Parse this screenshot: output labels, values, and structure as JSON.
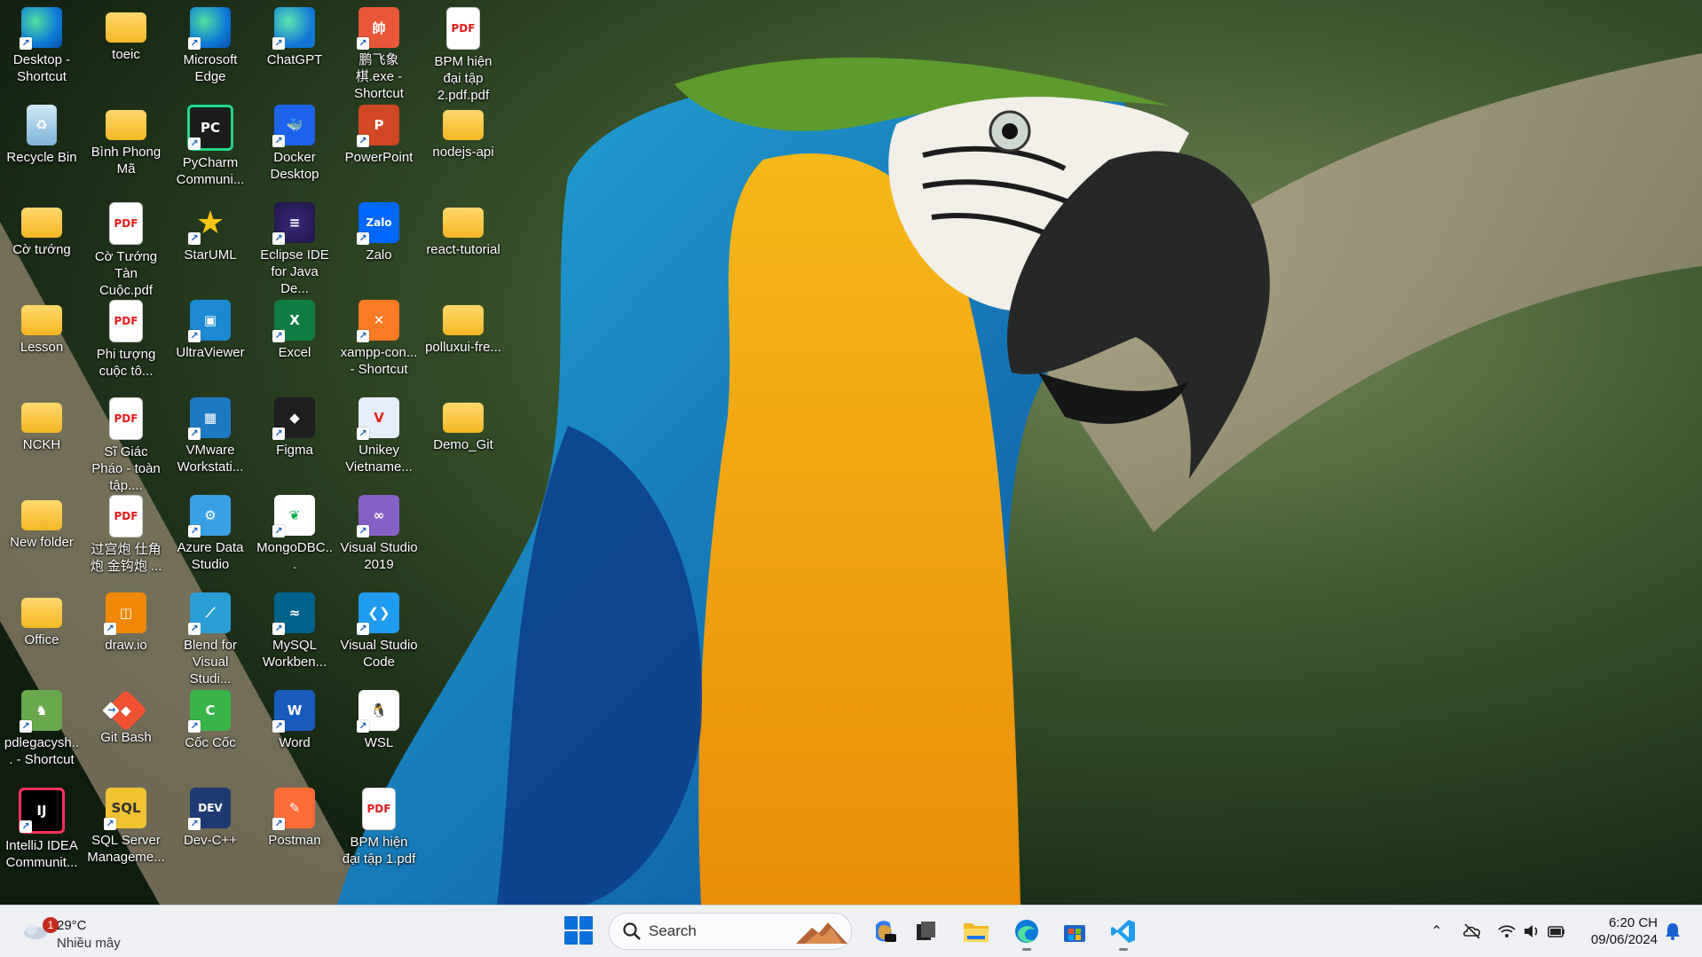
{
  "desktop": {
    "icons": [
      {
        "label": "Desktop - Shortcut",
        "icon": "desktop-icon",
        "col": 0,
        "row": 0
      },
      {
        "label": "toeic",
        "icon": "folder-icon",
        "col": 1,
        "row": 0
      },
      {
        "label": "Microsoft Edge",
        "icon": "edge-icon",
        "col": 2,
        "row": 0
      },
      {
        "label": "ChatGPT",
        "icon": "chatgpt-icon",
        "col": 3,
        "row": 0
      },
      {
        "label": "鹏飞象棋.exe - Shortcut",
        "icon": "chess-icon",
        "col": 4,
        "row": 0
      },
      {
        "label": "BPM hiện đại tập 2.pdf.pdf",
        "icon": "pdf-icon",
        "col": 5,
        "row": 0
      },
      {
        "label": "Recycle Bin",
        "icon": "recycle-bin-icon",
        "col": 0,
        "row": 1
      },
      {
        "label": "Bình Phong Mã",
        "icon": "folder-icon",
        "col": 1,
        "row": 1
      },
      {
        "label": "PyCharm Communi...",
        "icon": "pycharm-icon",
        "col": 2,
        "row": 1
      },
      {
        "label": "Docker Desktop",
        "icon": "docker-icon",
        "col": 3,
        "row": 1
      },
      {
        "label": "PowerPoint",
        "icon": "powerpoint-icon",
        "col": 4,
        "row": 1
      },
      {
        "label": "nodejs-api",
        "icon": "folder-icon",
        "col": 5,
        "row": 1
      },
      {
        "label": "Cờ tướng",
        "icon": "folder-icon",
        "col": 0,
        "row": 2
      },
      {
        "label": "Cờ Tướng Tàn Cuộc.pdf",
        "icon": "pdf-icon",
        "col": 1,
        "row": 2
      },
      {
        "label": "StarUML",
        "icon": "staruml-icon",
        "col": 2,
        "row": 2
      },
      {
        "label": "Eclipse IDE for Java De...",
        "icon": "eclipse-icon",
        "col": 3,
        "row": 2
      },
      {
        "label": "Zalo",
        "icon": "zalo-icon",
        "col": 4,
        "row": 2
      },
      {
        "label": "react-tutorial",
        "icon": "folder-icon",
        "col": 5,
        "row": 2
      },
      {
        "label": "Lesson",
        "icon": "folder-icon",
        "col": 0,
        "row": 3
      },
      {
        "label": "Phi tượng cuộc tô...",
        "icon": "pdf-icon",
        "col": 1,
        "row": 3
      },
      {
        "label": "UltraViewer",
        "icon": "ultraviewer-icon",
        "col": 2,
        "row": 3
      },
      {
        "label": "Excel",
        "icon": "excel-icon",
        "col": 3,
        "row": 3
      },
      {
        "label": "xampp-con... - Shortcut",
        "icon": "xampp-icon",
        "col": 4,
        "row": 3
      },
      {
        "label": "polluxui-fre...",
        "icon": "folder-icon",
        "col": 5,
        "row": 3
      },
      {
        "label": "NCKH",
        "icon": "folder-icon",
        "col": 0,
        "row": 4
      },
      {
        "label": "Sĩ Giác Pháo - toàn tập....",
        "icon": "pdf-icon",
        "col": 1,
        "row": 4
      },
      {
        "label": "VMware Workstati...",
        "icon": "vmware-icon",
        "col": 2,
        "row": 4
      },
      {
        "label": "Figma",
        "icon": "figma-icon",
        "col": 3,
        "row": 4
      },
      {
        "label": "Unikey Vietname...",
        "icon": "unikey-icon",
        "col": 4,
        "row": 4
      },
      {
        "label": "Demo_Git",
        "icon": "folder-icon",
        "col": 5,
        "row": 4
      },
      {
        "label": "New folder",
        "icon": "folder-icon",
        "col": 0,
        "row": 5
      },
      {
        "label": "过宫炮 仕角炮 金钩炮 ...",
        "icon": "pdf-icon",
        "col": 1,
        "row": 5
      },
      {
        "label": "Azure Data Studio",
        "icon": "azure-data-studio-icon",
        "col": 2,
        "row": 5
      },
      {
        "label": "MongoDBC...",
        "icon": "mongodb-icon",
        "col": 3,
        "row": 5
      },
      {
        "label": "Visual Studio 2019",
        "icon": "visual-studio-icon",
        "col": 4,
        "row": 5
      },
      {
        "label": "Office",
        "icon": "folder-icon",
        "col": 0,
        "row": 6
      },
      {
        "label": "draw.io",
        "icon": "drawio-icon",
        "col": 1,
        "row": 6
      },
      {
        "label": "Blend for Visual Studi...",
        "icon": "blend-icon",
        "col": 2,
        "row": 6
      },
      {
        "label": "MySQL Workben...",
        "icon": "mysql-workbench-icon",
        "col": 3,
        "row": 6
      },
      {
        "label": "Visual Studio Code",
        "icon": "vscode-icon",
        "col": 4,
        "row": 6
      },
      {
        "label": "pdlegacysh... - Shortcut",
        "icon": "pdlegacy-icon",
        "col": 0,
        "row": 7
      },
      {
        "label": "Git Bash",
        "icon": "git-bash-icon",
        "col": 1,
        "row": 7
      },
      {
        "label": "Cốc Cốc",
        "icon": "coccoc-icon",
        "col": 2,
        "row": 7
      },
      {
        "label": "Word",
        "icon": "word-icon",
        "col": 3,
        "row": 7
      },
      {
        "label": "WSL",
        "icon": "wsl-icon",
        "col": 4,
        "row": 7
      },
      {
        "label": "IntelliJ IDEA Communit...",
        "icon": "intellij-icon",
        "col": 0,
        "row": 8
      },
      {
        "label": "SQL Server Manageme...",
        "icon": "sql-server-icon",
        "col": 1,
        "row": 8
      },
      {
        "label": "Dev-C++",
        "icon": "devcpp-icon",
        "col": 2,
        "row": 8
      },
      {
        "label": "Postman",
        "icon": "postman-icon",
        "col": 3,
        "row": 8
      },
      {
        "label": "BPM hiện đại tập 1.pdf",
        "icon": "pdf-icon",
        "col": 4,
        "row": 8
      }
    ]
  },
  "taskbar": {
    "weather": {
      "temp": "29°C",
      "condition": "Nhiều mây",
      "badge": "1"
    },
    "search": {
      "placeholder": "Search"
    },
    "apps": [
      "copilot-icon",
      "task-view-icon",
      "file-explorer-icon",
      "edge-icon",
      "microsoft-store-icon",
      "vscode-icon"
    ],
    "clock": {
      "time": "6:20 CH",
      "date": "09/06/2024"
    }
  }
}
